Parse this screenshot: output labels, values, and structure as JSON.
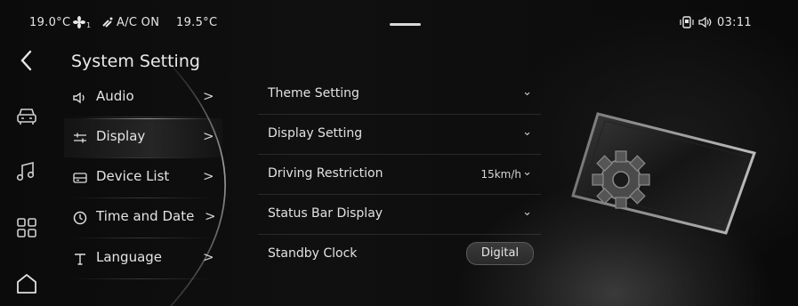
{
  "status_bar": {
    "temp_left": "19.0°C",
    "fan_level": "1",
    "ac_text": "A/C ON",
    "temp_right": "19.5°C",
    "time": "03:11"
  },
  "rail": {
    "icons": [
      "back-icon",
      "car-icon",
      "music-icon",
      "apps-icon",
      "home-icon"
    ]
  },
  "menu": {
    "title": "System Setting",
    "arrow": ">",
    "items": [
      {
        "label": "Audio",
        "icon": "speaker-icon"
      },
      {
        "label": "Display",
        "icon": "sliders-icon",
        "active": true
      },
      {
        "label": "Device List",
        "icon": "device-icon"
      },
      {
        "label": "Time and Date",
        "icon": "clock-icon"
      },
      {
        "label": "Language",
        "icon": "text-icon"
      }
    ]
  },
  "settings": {
    "chevron": "⌄",
    "rows": [
      {
        "label": "Theme Setting"
      },
      {
        "label": "Display Setting"
      },
      {
        "label": "Driving Restriction",
        "value": "15km/h"
      },
      {
        "label": "Status Bar Display"
      },
      {
        "label": "Standby Clock",
        "value": "Digital"
      }
    ]
  },
  "colors": {
    "background": "#050505",
    "text": "#e4e4e4",
    "accent": "#ffffff"
  }
}
